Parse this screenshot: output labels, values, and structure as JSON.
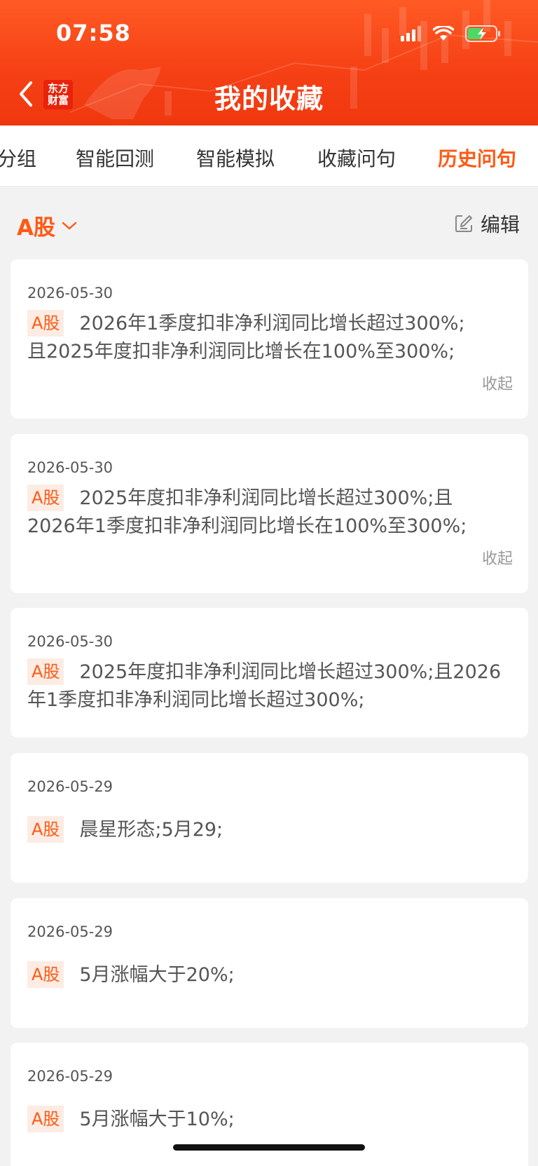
{
  "status_bar": {
    "time": "07:58"
  },
  "header": {
    "title": "我的收藏",
    "logo_line1": "东方",
    "logo_line2": "财富"
  },
  "tabs": [
    {
      "label": "分组"
    },
    {
      "label": "智能回测"
    },
    {
      "label": "智能模拟"
    },
    {
      "label": "收藏问句"
    },
    {
      "label": "历史问句",
      "active": true
    }
  ],
  "filter": {
    "market": "A股",
    "edit_label": "编辑"
  },
  "cards": [
    {
      "date": "2026-05-30",
      "tag": "A股",
      "text": "2026年1季度扣非净利润同比增长超过300%;且2025年度扣非净利润同比增长在100%至300%;",
      "collapse": "收起"
    },
    {
      "date": "2026-05-30",
      "tag": "A股",
      "text": "2025年度扣非净利润同比增长超过300%;且2026年1季度扣非净利润同比增长在100%至300%;",
      "collapse": "收起"
    },
    {
      "date": "2026-05-30",
      "tag": "A股",
      "text": "2025年度扣非净利润同比增长超过300%;且2026年1季度扣非净利润同比增长超过300%;"
    },
    {
      "date": "2026-05-29",
      "tag": "A股",
      "text": "晨星形态;5月29;"
    },
    {
      "date": "2026-05-29",
      "tag": "A股",
      "text": "5月涨幅大于20%;"
    },
    {
      "date": "2026-05-29",
      "tag": "A股",
      "text": "5月涨幅大于10%;"
    }
  ],
  "colors": {
    "accent": "#ff5a14",
    "header_bg": "#f53f14"
  }
}
